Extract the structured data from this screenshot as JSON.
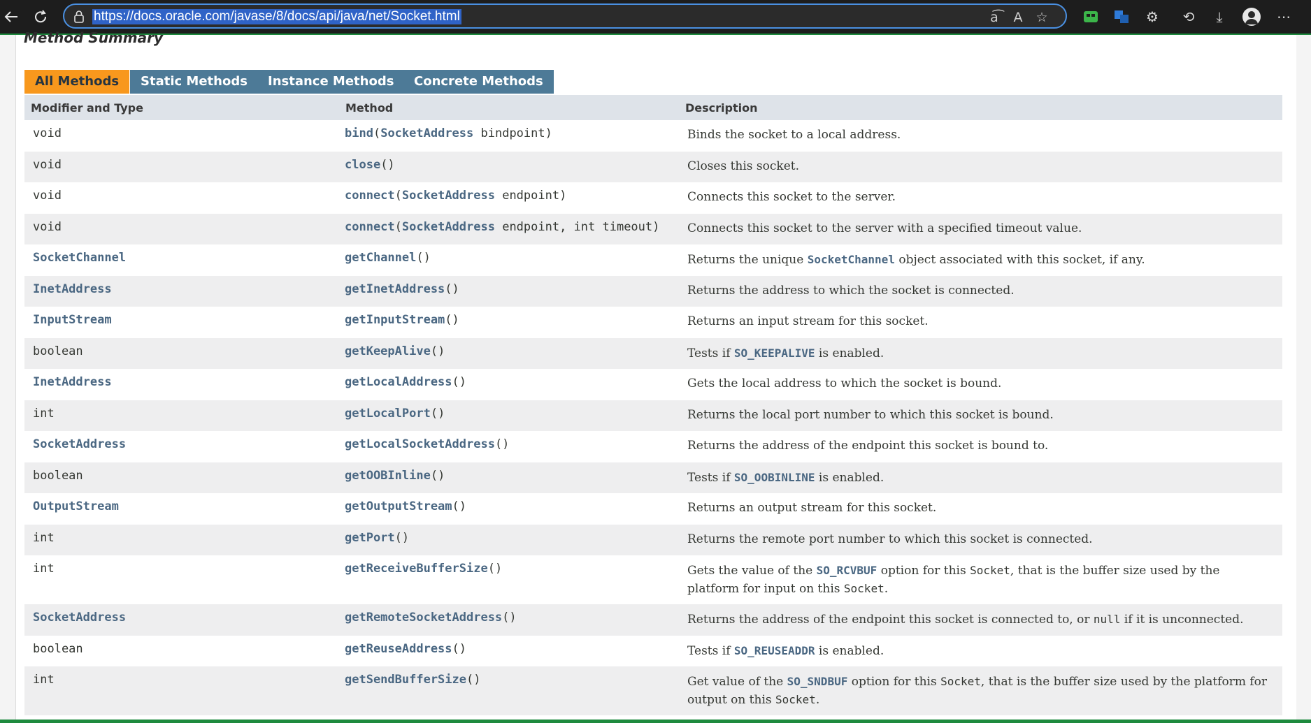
{
  "browser": {
    "url": "https://docs.oracle.com/javase/8/docs/api/java/net/Socket.html",
    "icons": [
      "back-arrow-icon",
      "refresh-icon",
      "lock-icon",
      "read-aloud-icon",
      "text-size-icon",
      "favorite-star-icon",
      "app-icon",
      "translate-icon",
      "extensions-icon",
      "history-icon",
      "downloads-icon",
      "profile-avatar-icon",
      "more-menu-icon"
    ]
  },
  "page": {
    "section_title": "Method Summary",
    "tabs": [
      {
        "label": "All Methods",
        "active": true
      },
      {
        "label": "Static Methods",
        "active": false
      },
      {
        "label": "Instance Methods",
        "active": false
      },
      {
        "label": "Concrete Methods",
        "active": false
      }
    ],
    "columns": [
      "Modifier and Type",
      "Method",
      "Description"
    ],
    "rows": [
      {
        "type": "void",
        "type_link": false,
        "method": "bind",
        "params_open": "(",
        "param_type": "SocketAddress",
        "params_rest": " bindpoint)",
        "desc": [
          {
            "t": "Binds the socket to a local address."
          }
        ]
      },
      {
        "type": "void",
        "type_link": false,
        "method": "close",
        "params_open": "()",
        "param_type": "",
        "params_rest": "",
        "desc": [
          {
            "t": "Closes this socket."
          }
        ]
      },
      {
        "type": "void",
        "type_link": false,
        "method": "connect",
        "params_open": "(",
        "param_type": "SocketAddress",
        "params_rest": " endpoint)",
        "desc": [
          {
            "t": "Connects this socket to the server."
          }
        ]
      },
      {
        "type": "void",
        "type_link": false,
        "method": "connect",
        "params_open": "(",
        "param_type": "SocketAddress",
        "params_rest": " endpoint, int timeout)",
        "desc": [
          {
            "t": "Connects this socket to the server with a specified timeout value."
          }
        ]
      },
      {
        "type": "SocketChannel",
        "type_link": true,
        "method": "getChannel",
        "params_open": "()",
        "param_type": "",
        "params_rest": "",
        "desc": [
          {
            "t": "Returns the unique "
          },
          {
            "code": "SocketChannel",
            "link": true
          },
          {
            "t": " object associated with this socket, if any."
          }
        ]
      },
      {
        "type": "InetAddress",
        "type_link": true,
        "method": "getInetAddress",
        "params_open": "()",
        "param_type": "",
        "params_rest": "",
        "desc": [
          {
            "t": "Returns the address to which the socket is connected."
          }
        ]
      },
      {
        "type": "InputStream",
        "type_link": true,
        "method": "getInputStream",
        "params_open": "()",
        "param_type": "",
        "params_rest": "",
        "desc": [
          {
            "t": "Returns an input stream for this socket."
          }
        ]
      },
      {
        "type": "boolean",
        "type_link": false,
        "method": "getKeepAlive",
        "params_open": "()",
        "param_type": "",
        "params_rest": "",
        "desc": [
          {
            "t": "Tests if "
          },
          {
            "code": "SO_KEEPALIVE",
            "link": true
          },
          {
            "t": " is enabled."
          }
        ]
      },
      {
        "type": "InetAddress",
        "type_link": true,
        "method": "getLocalAddress",
        "params_open": "()",
        "param_type": "",
        "params_rest": "",
        "desc": [
          {
            "t": "Gets the local address to which the socket is bound."
          }
        ]
      },
      {
        "type": "int",
        "type_link": false,
        "method": "getLocalPort",
        "params_open": "()",
        "param_type": "",
        "params_rest": "",
        "desc": [
          {
            "t": "Returns the local port number to which this socket is bound."
          }
        ]
      },
      {
        "type": "SocketAddress",
        "type_link": true,
        "method": "getLocalSocketAddress",
        "params_open": "()",
        "param_type": "",
        "params_rest": "",
        "desc": [
          {
            "t": "Returns the address of the endpoint this socket is bound to."
          }
        ]
      },
      {
        "type": "boolean",
        "type_link": false,
        "method": "getOOBInline",
        "params_open": "()",
        "param_type": "",
        "params_rest": "",
        "desc": [
          {
            "t": "Tests if "
          },
          {
            "code": "SO_OOBINLINE",
            "link": true
          },
          {
            "t": " is enabled."
          }
        ]
      },
      {
        "type": "OutputStream",
        "type_link": true,
        "method": "getOutputStream",
        "params_open": "()",
        "param_type": "",
        "params_rest": "",
        "desc": [
          {
            "t": "Returns an output stream for this socket."
          }
        ]
      },
      {
        "type": "int",
        "type_link": false,
        "method": "getPort",
        "params_open": "()",
        "param_type": "",
        "params_rest": "",
        "desc": [
          {
            "t": "Returns the remote port number to which this socket is connected."
          }
        ]
      },
      {
        "type": "int",
        "type_link": false,
        "method": "getReceiveBufferSize",
        "params_open": "()",
        "param_type": "",
        "params_rest": "",
        "tall": true,
        "desc": [
          {
            "t": "Gets the value of the "
          },
          {
            "code": "SO_RCVBUF",
            "link": true
          },
          {
            "t": " option for this "
          },
          {
            "code": "Socket",
            "link": false
          },
          {
            "t": ", that is the buffer size used by the platform for input on this "
          },
          {
            "code": "Socket",
            "link": false
          },
          {
            "t": "."
          }
        ]
      },
      {
        "type": "SocketAddress",
        "type_link": true,
        "method": "getRemoteSocketAddress",
        "params_open": "()",
        "param_type": "",
        "params_rest": "",
        "desc": [
          {
            "t": "Returns the address of the endpoint this socket is connected to, or "
          },
          {
            "code": "null",
            "link": false
          },
          {
            "t": " if it is unconnected."
          }
        ]
      },
      {
        "type": "boolean",
        "type_link": false,
        "method": "getReuseAddress",
        "params_open": "()",
        "param_type": "",
        "params_rest": "",
        "desc": [
          {
            "t": "Tests if "
          },
          {
            "code": "SO_REUSEADDR",
            "link": true
          },
          {
            "t": " is enabled."
          }
        ]
      },
      {
        "type": "int",
        "type_link": false,
        "method": "getSendBufferSize",
        "params_open": "()",
        "param_type": "",
        "params_rest": "",
        "tall": true,
        "desc": [
          {
            "t": "Get value of the "
          },
          {
            "code": "SO_SNDBUF",
            "link": true
          },
          {
            "t": " option for this "
          },
          {
            "code": "Socket",
            "link": false
          },
          {
            "t": ", that is the buffer size used by the platform for output on this "
          },
          {
            "code": "Socket",
            "link": false
          },
          {
            "t": "."
          }
        ]
      }
    ]
  }
}
